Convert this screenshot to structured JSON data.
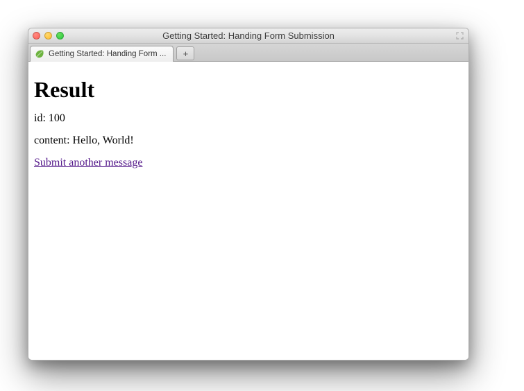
{
  "window": {
    "title": "Getting Started: Handing Form Submission"
  },
  "tab": {
    "label": "Getting Started: Handing Form ..."
  },
  "newtab": {
    "label": "+"
  },
  "page": {
    "heading": "Result",
    "id_line": "id: 100",
    "content_line": "content: Hello, World!",
    "link_text": "Submit another message"
  }
}
